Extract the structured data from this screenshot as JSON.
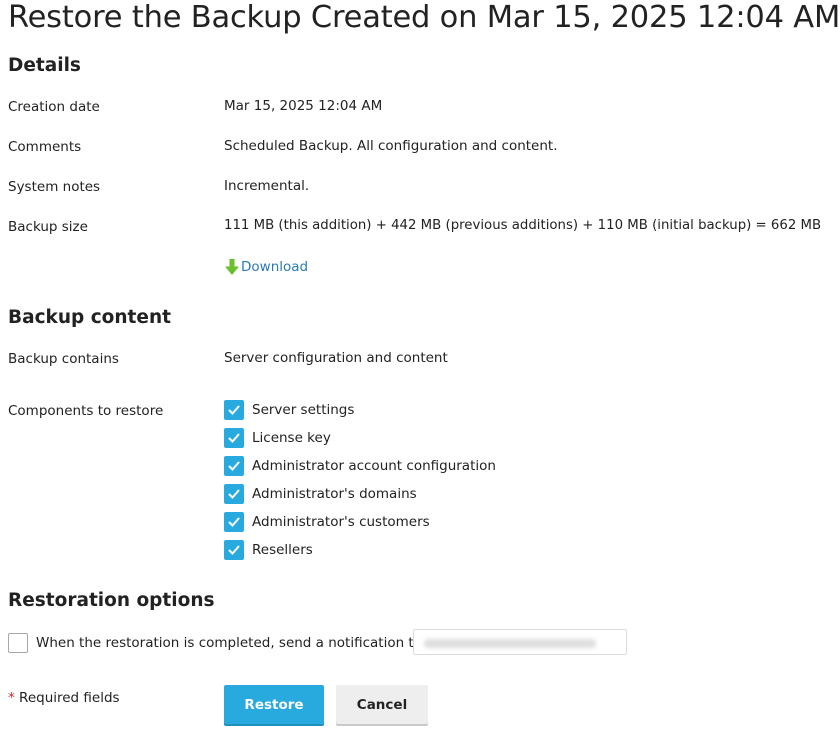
{
  "title": "Restore the Backup Created on Mar 15, 2025 12:04 AM",
  "details": {
    "heading": "Details",
    "rows": [
      {
        "label": "Creation date",
        "value": "Mar 15, 2025 12:04 AM"
      },
      {
        "label": "Comments",
        "value": "Scheduled Backup. All configuration and content."
      },
      {
        "label": "System notes",
        "value": "Incremental."
      },
      {
        "label": "Backup size",
        "value": "111 MB (this addition) + 442 MB (previous additions) + 110 MB (initial backup) = 662 MB"
      }
    ],
    "download_label": "Download",
    "download_icon": "download-arrow-icon"
  },
  "backup_content": {
    "heading": "Backup content",
    "contains_label": "Backup contains",
    "contains_value": "Server configuration and content",
    "components_label": "Components to restore",
    "components": [
      {
        "label": "Server settings",
        "checked": true
      },
      {
        "label": "License key",
        "checked": true
      },
      {
        "label": "Administrator account configuration",
        "checked": true
      },
      {
        "label": "Administrator's domains",
        "checked": true
      },
      {
        "label": "Administrator's customers",
        "checked": true
      },
      {
        "label": "Resellers",
        "checked": true
      }
    ]
  },
  "restoration": {
    "heading": "Restoration options",
    "notify_label": "When the restoration is completed, send a notification to",
    "notify_checked": false
  },
  "footer": {
    "required_asterisk": "*",
    "required_text": "Required fields",
    "restore_label": "Restore",
    "cancel_label": "Cancel"
  },
  "colors": {
    "accent": "#28aade",
    "link": "#2a7bb5",
    "download_icon": "#6cbf2c",
    "required": "#d02b2b"
  }
}
